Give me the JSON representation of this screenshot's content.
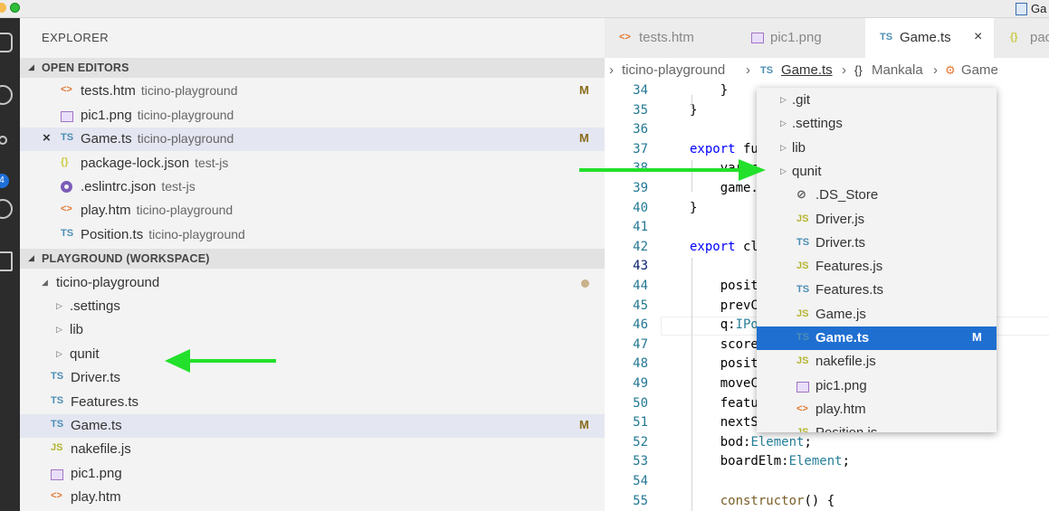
{
  "mac_bar": {
    "app_label": "Ga"
  },
  "activity_bar": {
    "badge": "4"
  },
  "sidebar": {
    "title": "EXPLORER",
    "open_editors": {
      "header": "OPEN EDITORS",
      "items": [
        {
          "icon": "<>",
          "name": "tests.htm",
          "desc": "ticino-playground",
          "status": "M"
        },
        {
          "icon": "img",
          "name": "pic1.png",
          "desc": "ticino-playground",
          "status": ""
        },
        {
          "icon": "TS",
          "name": "Game.ts",
          "desc": "ticino-playground",
          "status": "M"
        },
        {
          "icon": "{}",
          "name": "package-lock.json",
          "desc": "test-js",
          "status": ""
        },
        {
          "icon": "eslint",
          "name": ".eslintrc.json",
          "desc": "test-js",
          "status": ""
        },
        {
          "icon": "<>",
          "name": "play.htm",
          "desc": "ticino-playground",
          "status": ""
        },
        {
          "icon": "TS",
          "name": "Position.ts",
          "desc": "ticino-playground",
          "status": ""
        }
      ],
      "close_glyph": "×"
    },
    "workspace": {
      "header": "PLAYGROUND (WORKSPACE)",
      "root": "ticino-playground",
      "items": [
        {
          "type": "folder",
          "name": ".settings"
        },
        {
          "type": "folder",
          "name": "lib"
        },
        {
          "type": "folder",
          "name": "qunit"
        },
        {
          "icon": "TS",
          "name": "Driver.ts",
          "status": ""
        },
        {
          "icon": "TS",
          "name": "Features.ts",
          "status": ""
        },
        {
          "icon": "TS",
          "name": "Game.ts",
          "status": "M"
        },
        {
          "icon": "JS",
          "name": "nakefile.js",
          "status": ""
        },
        {
          "icon": "img",
          "name": "pic1.png",
          "status": ""
        },
        {
          "icon": "<>",
          "name": "play.htm",
          "status": ""
        }
      ]
    }
  },
  "tabs": [
    {
      "icon": "<>",
      "label": "tests.htm"
    },
    {
      "icon": "img",
      "label": "pic1.png"
    },
    {
      "icon": "TS",
      "label": "Game.ts",
      "close": "×"
    },
    {
      "icon": "{}",
      "label": "pac"
    }
  ],
  "breadcrumbs": {
    "folder": "ticino-playground",
    "file_icon": "TS",
    "file": "Game.ts",
    "ns_icon": "{}",
    "ns": "Mankala",
    "cls": "Game",
    "sep": "›"
  },
  "code": {
    "current_line": "43",
    "lines": [
      {
        "n": "34",
        "t": "    }"
      },
      {
        "n": "35",
        "t": "}"
      },
      {
        "n": "36",
        "t": ""
      },
      {
        "n": "37",
        "kw": "export",
        "t": " fu"
      },
      {
        "n": "38",
        "t": "    var c"
      },
      {
        "n": "39",
        "t": "    game."
      },
      {
        "n": "40",
        "t": "}"
      },
      {
        "n": "41",
        "t": ""
      },
      {
        "n": "42",
        "kw": "export",
        "t": " cl"
      },
      {
        "n": "43",
        "t": ""
      },
      {
        "n": "44",
        "t": "    posit"
      },
      {
        "n": "45",
        "t": "    prevC"
      },
      {
        "n": "46",
        "t": "    q:",
        "ty": "IPo"
      },
      {
        "n": "47",
        "t": "    score"
      },
      {
        "n": "48",
        "t": "    posit"
      },
      {
        "n": "49",
        "t": "    moveC"
      },
      {
        "n": "50",
        "t": "    featu"
      },
      {
        "n": "51",
        "t": "    nextS"
      },
      {
        "n": "52",
        "t": "    bod:",
        "ty": "Element",
        "t2": ";"
      },
      {
        "n": "53",
        "t": "    boardElm:",
        "ty": "Element",
        "t2": ";"
      },
      {
        "n": "54",
        "t": ""
      },
      {
        "n": "55",
        "fn": "    constructor",
        "t": "() {"
      }
    ]
  },
  "dropdown": {
    "items": [
      {
        "type": "folder",
        "name": ".git"
      },
      {
        "type": "folder",
        "name": ".settings"
      },
      {
        "type": "folder",
        "name": "lib"
      },
      {
        "type": "folder",
        "name": "qunit"
      },
      {
        "icon": "hidden",
        "name": ".DS_Store"
      },
      {
        "icon": "JS",
        "name": "Driver.js"
      },
      {
        "icon": "TS",
        "name": "Driver.ts"
      },
      {
        "icon": "JS",
        "name": "Features.js"
      },
      {
        "icon": "TS",
        "name": "Features.ts"
      },
      {
        "icon": "JS",
        "name": "Game.js"
      },
      {
        "icon": "TS",
        "name": "Game.ts",
        "status": "M",
        "selected": true
      },
      {
        "icon": "JS",
        "name": "nakefile.js"
      },
      {
        "icon": "img",
        "name": "pic1.png"
      },
      {
        "icon": "<>",
        "name": "play.htm"
      },
      {
        "icon": "JS",
        "name": "Position.js"
      }
    ]
  },
  "colors": {
    "arrow": "#22e02b",
    "selection": "#1f6fd1",
    "modified": "#8a6d1c"
  }
}
